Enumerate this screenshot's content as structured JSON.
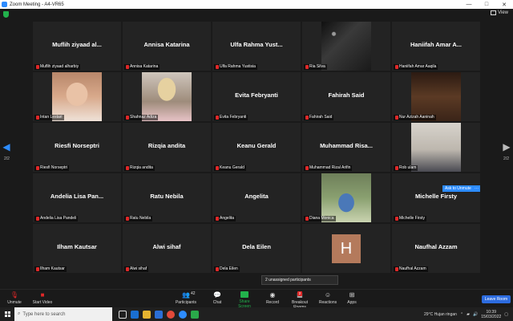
{
  "window": {
    "title": "Zoom Meeting - A4-VR65",
    "minimize": "—",
    "maximize": "□",
    "close": "✕"
  },
  "header": {
    "view_label": "View"
  },
  "navigation": {
    "left_arrow": "◀",
    "right_arrow": "▶",
    "page_left": "2/2",
    "page_right": "2/2"
  },
  "participants": [
    {
      "name": "Muflih ziyaad al...",
      "label": "Muflih ziyaad alharbiy",
      "video": ""
    },
    {
      "name": "Annisa Katarina",
      "label": "Annisa Katarina",
      "video": ""
    },
    {
      "name": "Ulfa Rahma Yust...",
      "label": "Ulfa Rahma Yustisia",
      "video": ""
    },
    {
      "name": "",
      "label": "Ria Silva",
      "video": "v-night"
    },
    {
      "name": "Haniifah Amar A...",
      "label": "Haniifah Amar Aaqila",
      "video": ""
    },
    {
      "name": "",
      "label": "Intan Lestari",
      "video": "v-girl1"
    },
    {
      "name": "",
      "label": "Shahnaz Adiza",
      "video": "v-girl2"
    },
    {
      "name": "Evita Febryanti",
      "label": "Evita Febryanti",
      "video": ""
    },
    {
      "name": "Fahirah Said",
      "label": "Fahirah Said",
      "video": ""
    },
    {
      "name": "",
      "label": "Nur Azizah Aaninah",
      "video": "v-room"
    },
    {
      "name": "Riesfi Norseptri",
      "label": "Riesfi Norseptri",
      "video": ""
    },
    {
      "name": "Rizqia andita",
      "label": "Rizqia andita",
      "video": ""
    },
    {
      "name": "Keanu Gerald",
      "label": "Keanu Gerald",
      "video": ""
    },
    {
      "name": "Muhammad Risa...",
      "label": "Muhammad Rizal Arifin",
      "video": ""
    },
    {
      "name": "",
      "label": "Rob ulam",
      "video": "v-couple"
    },
    {
      "name": "Andelia Lisa Pan...",
      "label": "Andelia Lisa Pandeli",
      "video": ""
    },
    {
      "name": "Ratu Nebila",
      "label": "Ratu Nebila",
      "video": ""
    },
    {
      "name": "Angelita",
      "label": "Angelita",
      "video": ""
    },
    {
      "name": "",
      "label": "Diana Monica",
      "video": "v-garden"
    },
    {
      "name": "Michelle Firsty",
      "label": "Michelle Firsty",
      "video": ""
    },
    {
      "name": "Ilham Kautsar",
      "label": "Ilham Kautsar",
      "video": ""
    },
    {
      "name": "Alwi sihaf",
      "label": "Alwi sihaf",
      "video": ""
    },
    {
      "name": "Dela Eilen",
      "label": "Dela Eilen",
      "video": ""
    },
    {
      "name": "",
      "label": "",
      "video": "avatar",
      "avatar_letter": "H"
    },
    {
      "name": "Naufhal Azzam",
      "label": "Naufhal Azzam",
      "video": ""
    }
  ],
  "ask_to_unmute": {
    "label": "Ask to Unmute",
    "more": "···"
  },
  "tooltip": {
    "text": "2 unassigned participants"
  },
  "toolbar": {
    "unmute": "Unmute",
    "start_video": "Start Video",
    "participants": "Participants",
    "participants_count": "42",
    "chat": "Chat",
    "share_screen": "Share Screen",
    "record": "Record",
    "breakout_rooms": "Breakout Rooms",
    "breakout_badge": "2",
    "reactions": "Reactions",
    "apps": "Apps",
    "leave_room": "Leave Room"
  },
  "taskbar": {
    "search_placeholder": "Type here to search",
    "weather": "29°C  Hujan ringan",
    "time": "10:39",
    "date": "15/03/2022"
  },
  "colors": {
    "accent": "#2d8cff",
    "share_green": "#22b14c",
    "mute_red": "#e02828"
  }
}
